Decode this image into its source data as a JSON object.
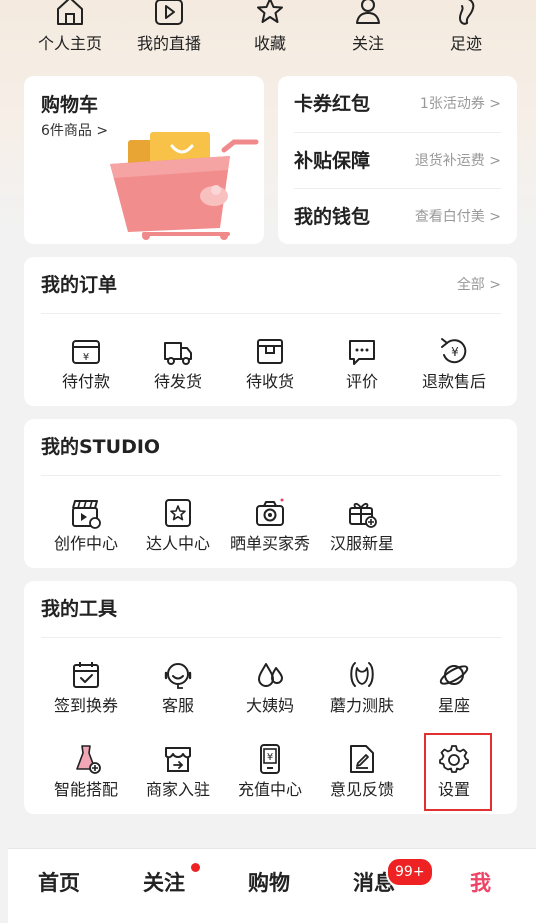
{
  "top_nav": [
    {
      "label": "个人主页",
      "icon": "home-icon"
    },
    {
      "label": "我的直播",
      "icon": "live-icon"
    },
    {
      "label": "收藏",
      "icon": "star-icon"
    },
    {
      "label": "关注",
      "icon": "user-follow-icon"
    },
    {
      "label": "足迹",
      "icon": "footprint-icon"
    }
  ],
  "cart": {
    "title": "购物车",
    "subtitle": "6件商品 >"
  },
  "links": [
    {
      "label": "卡券红包",
      "value": "1张活动券 >"
    },
    {
      "label": "补贴保障",
      "value": "退货补运费 >"
    },
    {
      "label": "我的钱包",
      "value": "查看白付美 >"
    }
  ],
  "orders": {
    "title": "我的订单",
    "more": "全部 >",
    "items": [
      {
        "label": "待付款",
        "icon": "wallet-icon"
      },
      {
        "label": "待发货",
        "icon": "truck-icon"
      },
      {
        "label": "待收货",
        "icon": "box-icon"
      },
      {
        "label": "评价",
        "icon": "comment-icon"
      },
      {
        "label": "退款售后",
        "icon": "refund-icon"
      }
    ]
  },
  "studio": {
    "title": "我的STUDIO",
    "items": [
      {
        "label": "创作中心",
        "icon": "clapperboard-icon"
      },
      {
        "label": "达人中心",
        "icon": "star-badge-icon"
      },
      {
        "label": "晒单买家秀",
        "icon": "camera-icon"
      },
      {
        "label": "汉服新星",
        "icon": "gift-icon"
      }
    ]
  },
  "tools": {
    "title": "我的工具",
    "items": [
      {
        "label": "签到换券",
        "icon": "calendar-check-icon"
      },
      {
        "label": "客服",
        "icon": "service-icon"
      },
      {
        "label": "大姨妈",
        "icon": "droplets-icon"
      },
      {
        "label": "蘑力测肤",
        "icon": "face-icon"
      },
      {
        "label": "星座",
        "icon": "planet-icon"
      },
      {
        "label": "智能搭配",
        "icon": "dress-icon"
      },
      {
        "label": "商家入驻",
        "icon": "store-icon"
      },
      {
        "label": "充值中心",
        "icon": "phone-recharge-icon"
      },
      {
        "label": "意见反馈",
        "icon": "feedback-icon"
      },
      {
        "label": "设置",
        "icon": "gear-icon"
      }
    ]
  },
  "tabbar": {
    "items": [
      "首页",
      "关注",
      "购物",
      "消息",
      "我"
    ],
    "messages_badge": "99+",
    "active": "我"
  },
  "colors": {
    "accent": "#ee4466",
    "highlight_border": "#e03030",
    "badge": "#ee2222"
  }
}
